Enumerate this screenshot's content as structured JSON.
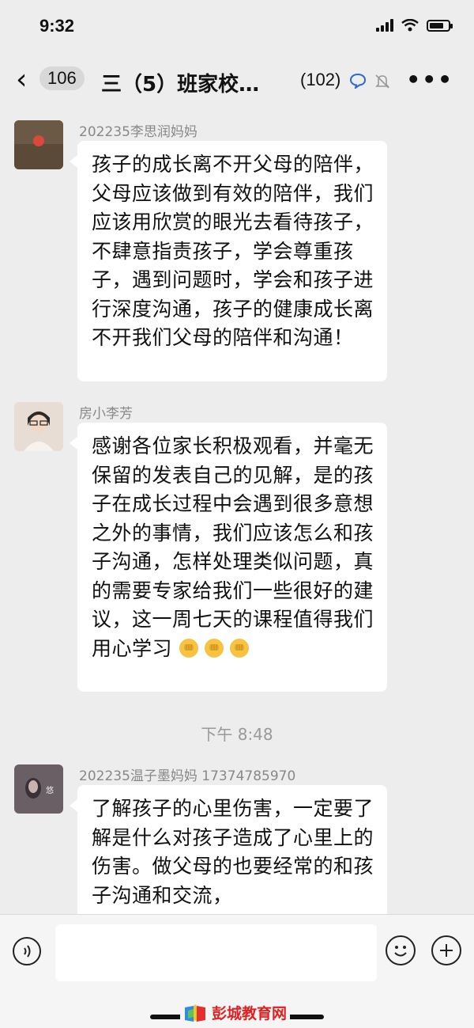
{
  "status": {
    "time": "9:32"
  },
  "nav": {
    "back_count": "106",
    "title": "三（5）班家校…",
    "member_count": "(102)"
  },
  "messages": [
    {
      "sender": "202235李思润妈妈",
      "text": "孩子的成长离不开父母的陪伴，父母应该做到有效的陪伴，我们应该用欣赏的眼光去看待孩子，不肆意指责孩子，学会尊重孩子，遇到问题时，学会和孩子进行深度沟通，孩子的健康成长离不开我们父母的陪伴和沟通！"
    },
    {
      "sender": "房小李芳",
      "text": "感谢各位家长积极观看，并毫无保留的发表自己的见解，是的孩子在成长过程中会遇到很多意想之外的事情，我们应该怎么和孩子沟通，怎样处理类似问题，真的需要专家给我们一些很好的建议，这一周七天的课程值得我们用心学习"
    },
    {
      "sender": "202235温子墨妈妈 17374785970",
      "text": "了解孩子的心里伤害，一定要了解是什么对孩子造成了心里上的伤害。做父母的也要经常的和孩子沟通和交流，"
    }
  ],
  "timestamp": "下午 8:48",
  "watermark": "彭城教育网",
  "icons": {
    "back": "chevron-left-icon",
    "voice": "voice-icon",
    "emoji": "emoji-icon",
    "plus": "plus-icon",
    "bell_muted": "bell-muted-icon",
    "chat_bubble": "chat-bubble-icon",
    "strong": "fist-emoji"
  },
  "colors": {
    "background": "#ededed",
    "bubble": "#ffffff",
    "sender": "#888888",
    "watermark": "#e02020",
    "nav_accent": "#2a6ad8"
  }
}
